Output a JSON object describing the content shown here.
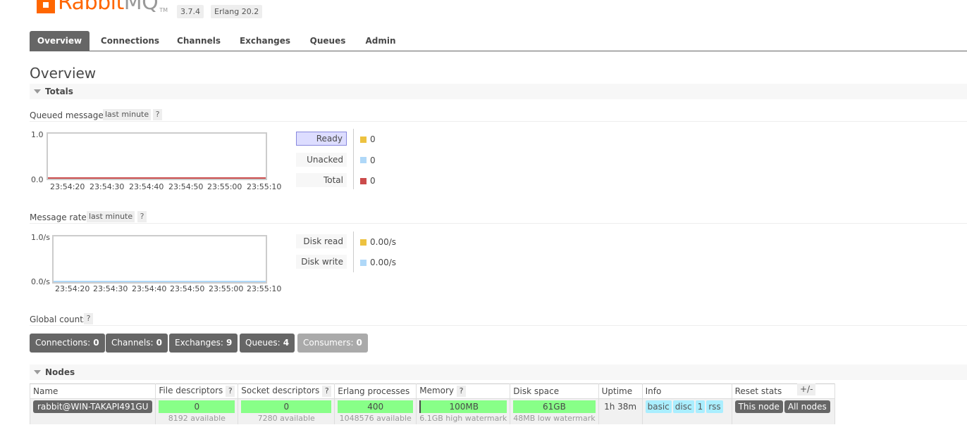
{
  "header": {
    "logo_main": "Rabbit",
    "logo_mq": "MQ",
    "logo_tm": "TM",
    "version": "3.7.4",
    "erlang": "Erlang 20.2"
  },
  "tabs": [
    "Overview",
    "Connections",
    "Channels",
    "Exchanges",
    "Queues",
    "Admin"
  ],
  "page_title": "Overview",
  "totals": {
    "section_label": "Totals",
    "queued": {
      "label": "Queued messages",
      "range": "last minute",
      "help": "?",
      "y_top": "1.0",
      "y_bottom": "0.0",
      "x_ticks": [
        "23:54:20",
        "23:54:30",
        "23:54:40",
        "23:54:50",
        "23:55:00",
        "23:55:10"
      ],
      "legend": [
        {
          "label": "Ready",
          "value": "0",
          "color": "#edc240"
        },
        {
          "label": "Unacked",
          "value": "0",
          "color": "#afd8f8"
        },
        {
          "label": "Total",
          "value": "0",
          "color": "#cb4b4b"
        }
      ]
    },
    "rates": {
      "label": "Message rates",
      "range": "last minute",
      "help": "?",
      "y_top": "1.0/s",
      "y_bottom": "0.0/s",
      "x_ticks": [
        "23:54:20",
        "23:54:30",
        "23:54:40",
        "23:54:50",
        "23:55:00",
        "23:55:10"
      ],
      "legend": [
        {
          "label": "Disk read",
          "value": "0.00/s",
          "color": "#edc240"
        },
        {
          "label": "Disk write",
          "value": "0.00/s",
          "color": "#afd8f8"
        }
      ]
    },
    "global_counts": {
      "label": "Global counts",
      "help": "?",
      "items": [
        {
          "label": "Connections:",
          "value": "0"
        },
        {
          "label": "Channels:",
          "value": "0"
        },
        {
          "label": "Exchanges:",
          "value": "9"
        },
        {
          "label": "Queues:",
          "value": "4"
        },
        {
          "label": "Consumers:",
          "value": "0"
        }
      ]
    }
  },
  "nodes": {
    "section_label": "Nodes",
    "toggle": "+/-",
    "headers": {
      "name": "Name",
      "fd": "File descriptors",
      "sockets": "Socket descriptors",
      "erlang": "Erlang processes",
      "memory": "Memory",
      "disk": "Disk space",
      "uptime": "Uptime",
      "info": "Info",
      "reset": "Reset stats",
      "help": "?"
    },
    "row": {
      "name": "rabbit@WIN-TAKAPI491GU",
      "fd": "0",
      "fd_sub": "8192 available",
      "sockets": "0",
      "sockets_sub": "7280 available",
      "erlang": "400",
      "erlang_sub": "1048576 available",
      "memory": "100MB",
      "memory_sub": "6.1GB high watermark",
      "disk": "61GB",
      "disk_sub": "48MB low watermark",
      "uptime": "1h 38m",
      "info": [
        "basic",
        "disc",
        "1",
        "rss"
      ],
      "reset_this": "This node",
      "reset_all": "All nodes"
    }
  }
}
